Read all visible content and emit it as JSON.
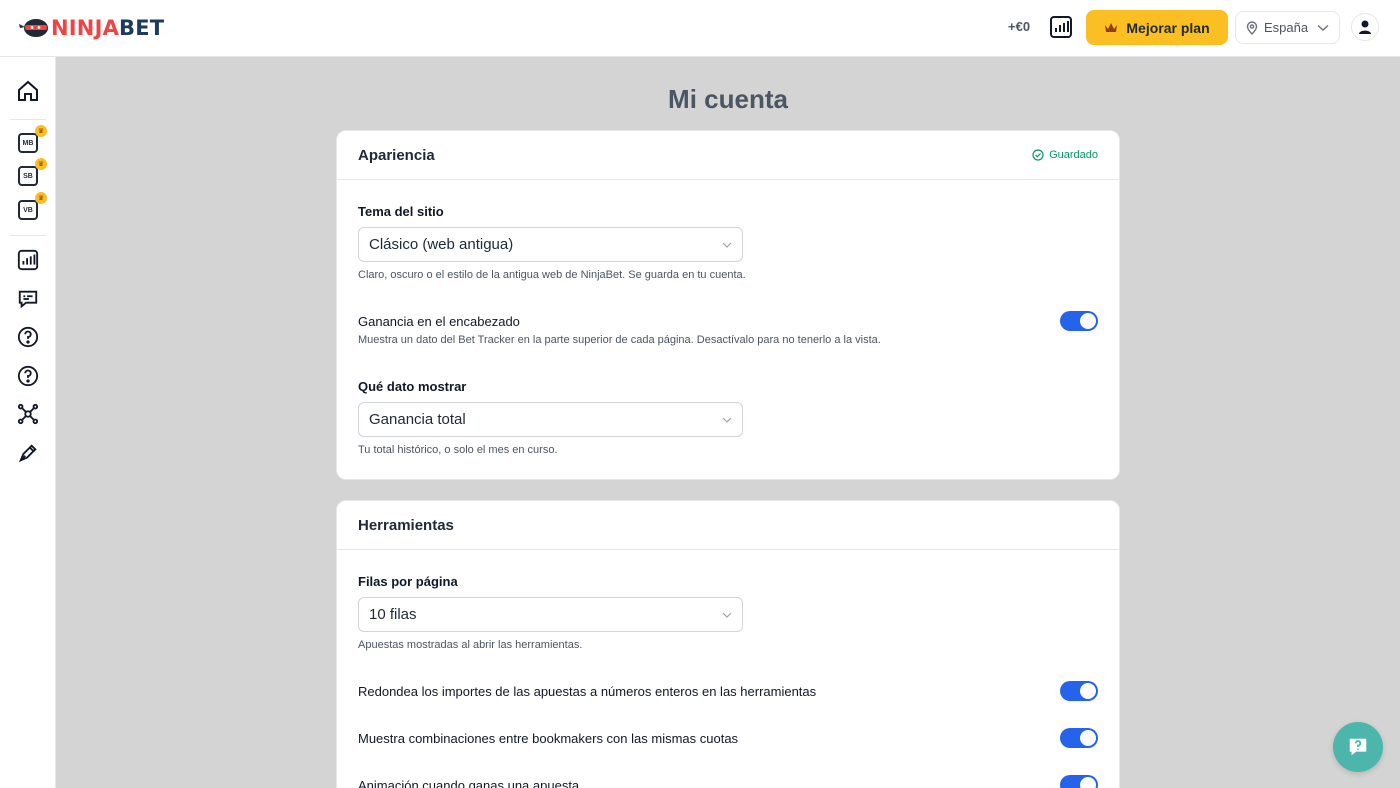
{
  "brand": {
    "part1": "NINJA",
    "part2": "BET"
  },
  "header": {
    "profit": "+€0",
    "upgrade_label": "Mejorar plan",
    "country": "España"
  },
  "sidebar": {
    "items": [
      {
        "name": "home",
        "label": ""
      },
      {
        "name": "mb",
        "label": "MB"
      },
      {
        "name": "sb",
        "label": "SB"
      },
      {
        "name": "vb",
        "label": "VB"
      }
    ]
  },
  "page": {
    "title": "Mi cuenta"
  },
  "appearance": {
    "title": "Apariencia",
    "saved_label": "Guardado",
    "theme_label": "Tema del sitio",
    "theme_value": "Clásico (web antigua)",
    "theme_hint": "Claro, oscuro o el estilo de la antigua web de NinjaBet. Se guarda en tu cuenta.",
    "header_profit_label": "Ganancia en el encabezado",
    "header_profit_hint": "Muestra un dato del Bet Tracker en la parte superior de cada página. Desactívalo para no tenerlo a la vista.",
    "header_profit_enabled": true,
    "data_label": "Qué dato mostrar",
    "data_value": "Ganancia total",
    "data_hint": "Tu total histórico, o solo el mes en curso."
  },
  "tools": {
    "title": "Herramientas",
    "rows_label": "Filas por página",
    "rows_value": "10 filas",
    "rows_hint": "Apuestas mostradas al abrir las herramientas.",
    "round_label": "Redondea los importes de las apuestas a números enteros en las herramientas",
    "round_enabled": true,
    "combos_label": "Muestra combinaciones entre bookmakers con las mismas cuotas",
    "combos_enabled": true,
    "anim_label": "Animación cuando ganas una apuesta",
    "anim_enabled": true
  },
  "colors": {
    "accent": "#2563eb",
    "brand_red": "#ef4444",
    "upgrade": "#fbbf24",
    "saved": "#059669"
  }
}
